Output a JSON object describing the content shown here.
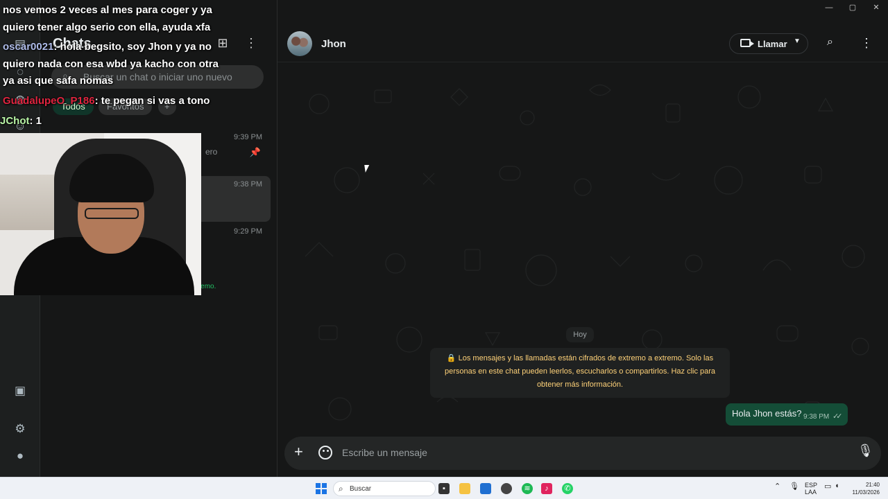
{
  "app": {
    "window_controls": [
      "—",
      "▢",
      "✕"
    ]
  },
  "rail": {
    "icons": [
      "chats-icon",
      "status-icon",
      "channels-icon",
      "communities-icon",
      "media-icon",
      "settings-icon",
      "profile-icon"
    ]
  },
  "chat_list": {
    "title": "Chats",
    "search_placeholder": "Buscar un chat o iniciar uno nuevo",
    "filters": [
      "Todos",
      "Favoritos",
      "+"
    ],
    "items": [
      {
        "time": "9:39 PM",
        "preview": "ero",
        "pinned": true
      },
      {
        "time": "9:38 PM",
        "preview": ""
      },
      {
        "time": "9:29 PM",
        "preview": ""
      }
    ],
    "encryption_note": "os de extremo a extremo."
  },
  "conversation": {
    "contact_name": "Jhon",
    "call_label": "Llamar",
    "day_label": "Hoy",
    "system_message": "🔒 Los mensajes y las llamadas están cifrados de extremo a extremo. Solo las personas en este chat pueden leerlos, escucharlos o compartirlos. Haz clic para obtener más información.",
    "messages": [
      {
        "text": "Hola Jhon estás?",
        "time": "9:38 PM",
        "status": "✓✓"
      }
    ],
    "composer_placeholder": "Escribe un mensaje"
  },
  "stream_overlay": {
    "lines": [
      {
        "user": "",
        "text": "nos vemos 2 veces al mes para coger y ya"
      },
      {
        "user": "",
        "text": "quiero tener algo serio con ella, ayuda xfa"
      },
      {
        "user": "oscar0021",
        "text": ": hola begsito, soy Jhon y ya no"
      },
      {
        "user": "",
        "text": "quiero nada con esa wbd ya kacho con otra"
      },
      {
        "user": "",
        "text": "ya asi que safa nomas"
      },
      {
        "user": "GuadalupeO_P186",
        "text": ": te pegan si vas a tono"
      },
      {
        "user": "JChot",
        "text": ": 1"
      }
    ]
  },
  "taskbar": {
    "search_label": "Buscar",
    "lang_top": "ESP",
    "lang_bottom": "LAA",
    "time": "21:40",
    "date": "11/03/2026"
  }
}
